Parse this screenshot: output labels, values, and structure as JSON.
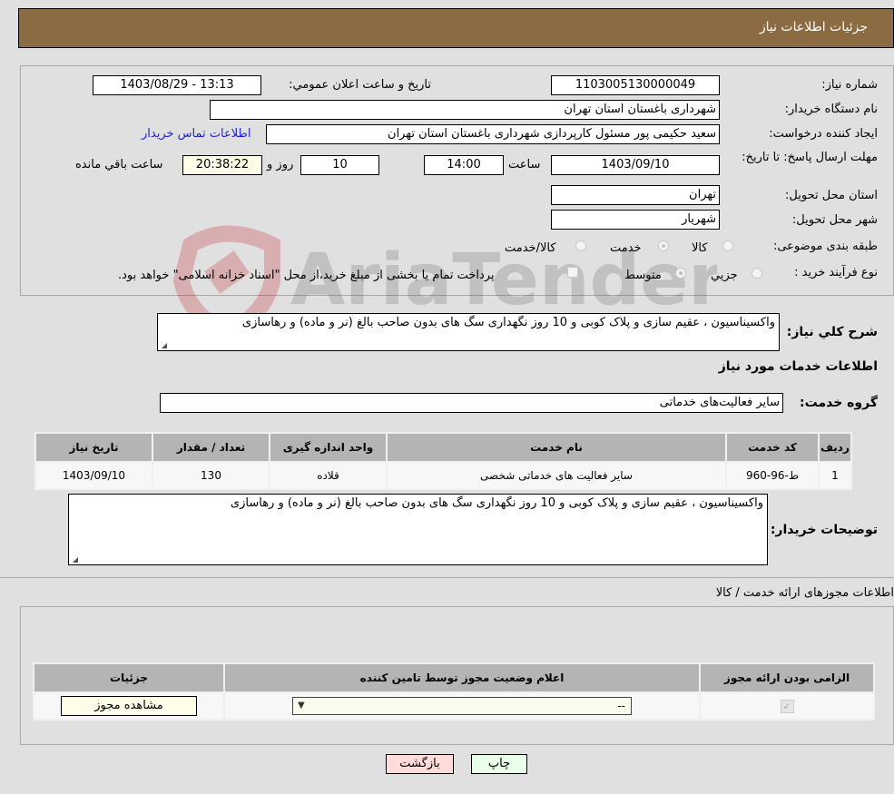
{
  "header": {
    "title": "جزئیات اطلاعات نیاز"
  },
  "form": {
    "need_number": {
      "label": "شماره نیاز:",
      "value": "1103005130000049"
    },
    "announce_datetime": {
      "label": "تاریخ و ساعت اعلان عمومي:",
      "value": "1403/08/29 - 13:13"
    },
    "buyer_org": {
      "label": "نام دستگاه خريدار:",
      "value": "شهرداری باغستان استان تهران"
    },
    "creator": {
      "label": "ایجاد کننده درخواست:",
      "value": "سعید حکیمی پور مسئول کارپردازی شهرداری باغستان استان تهران",
      "contact_link": "اطلاعات تماس خریدار"
    },
    "deadline": {
      "label": "مهلت ارسال پاسخ: تا تاریخ:",
      "date": "1403/09/10",
      "time_label": "ساعت",
      "time": "14:00",
      "days": "10",
      "days_label": "روز و",
      "remaining": "20:38:22",
      "remaining_label": "ساعت باقي مانده"
    },
    "province": {
      "label": "استان محل تحویل:",
      "value": "تهران"
    },
    "city": {
      "label": "شهر محل تحویل:",
      "value": "شهریار"
    },
    "category": {
      "label": "طبقه بندی موضوعی:",
      "options": [
        "کالا",
        "خدمت",
        "کالا/خدمت"
      ],
      "selected": "خدمت"
    },
    "purchase_type": {
      "label": "نوع فرآیند خرید :",
      "options": [
        "جزیي",
        "متوسط"
      ],
      "selected": "متوسط",
      "treasury_note": "پرداخت تمام یا بخشی از مبلغ خرید،از محل \"اسناد خزانه اسلامی\" خواهد بود."
    }
  },
  "general_description": {
    "label": "شرح کلي نیاز:",
    "value": "واکسیناسیون ، عقیم سازی و پلاک کوبی و 10 روز نگهداری سگ های بدون صاحب بالغ (نر و ماده) و رهاسازی"
  },
  "services_section": {
    "title": "اطلاعات خدمات مورد نیاز",
    "group_label": "گروه خدمت:",
    "group_value": "سایر فعالیت‌های خدماتی",
    "table": {
      "columns": [
        "ردیف",
        "کد خدمت",
        "نام خدمت",
        "واحد اندازه گیری",
        "تعداد / مقدار",
        "تاریخ نیاز"
      ],
      "rows": [
        [
          "1",
          "ط-96-960",
          "سایر فعالیت های خدماتی شخصی",
          "قلاده",
          "130",
          "1403/09/10"
        ]
      ]
    }
  },
  "buyer_notes": {
    "label": "توضیحات خریدار:",
    "value": "واکسیناسیون ، عقیم سازی و پلاک کوبی و 10 روز نگهداری سگ های بدون صاحب بالغ (نر و ماده) و رهاسازی"
  },
  "permits": {
    "title": "اطلاعات مجوزهای ارائه خدمت / کالا",
    "columns": [
      "الزامی بودن ارائه مجوز",
      "اعلام وضعیت مجوز توسط تامین کننده",
      "جزئیات"
    ],
    "row": {
      "required_checked": true,
      "status_value": "--",
      "details_button": "مشاهده مجوز"
    }
  },
  "actions": {
    "print": "چاپ",
    "back": "بازگشت"
  },
  "colors": {
    "header_bg": "#8b6b41",
    "back_btn_bg": "#ffdcdc",
    "print_btn_bg": "#eaffea",
    "cream": "#fefde8"
  }
}
